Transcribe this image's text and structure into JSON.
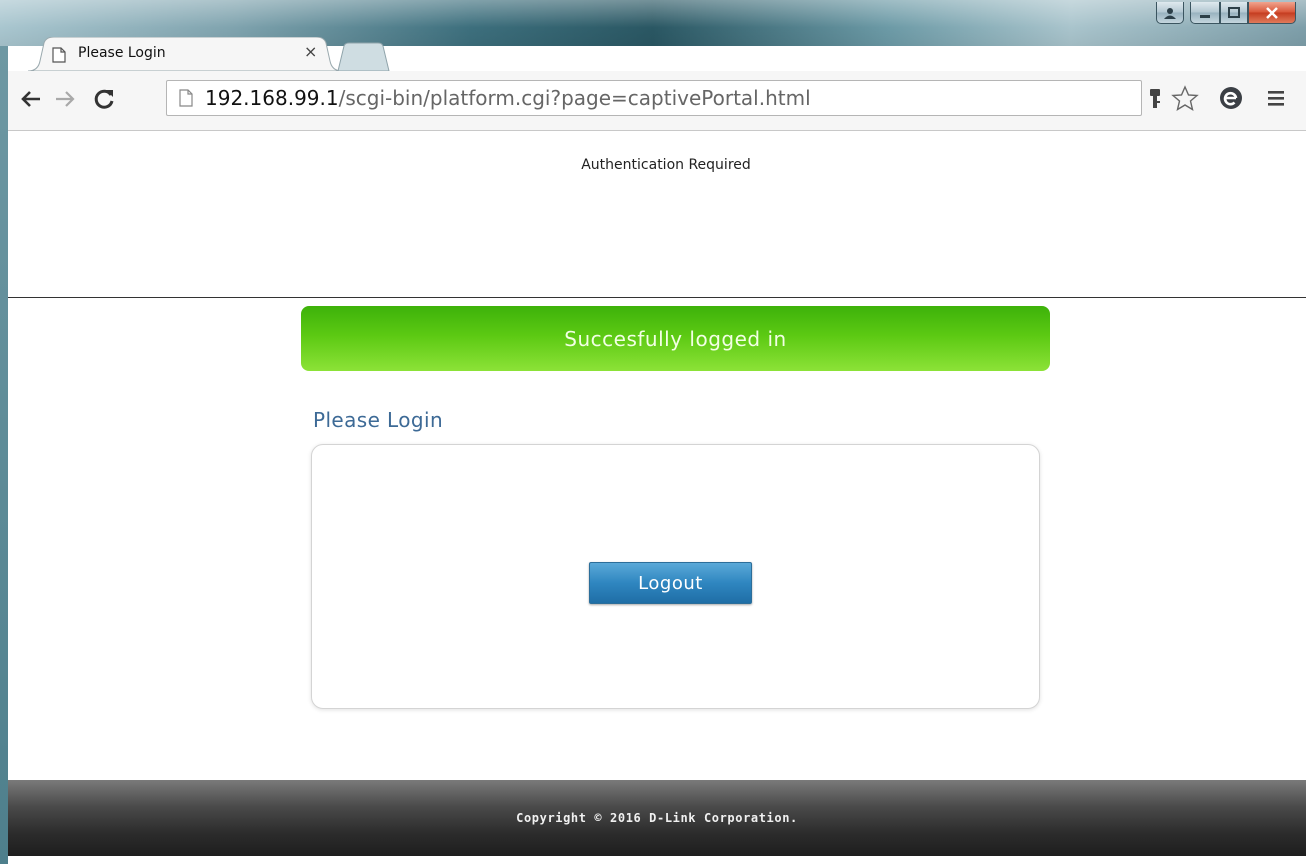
{
  "browser": {
    "tab": {
      "title": "Please Login",
      "close_glyph": "×"
    },
    "address_bar": {
      "host": "192.168.99.1",
      "path": "/scgi-bin/platform.cgi?page=captivePortal.html"
    },
    "icons": [
      "back-icon",
      "forward-icon",
      "reload-icon",
      "page-icon",
      "key-icon",
      "star-icon",
      "extension-icon",
      "menu-icon"
    ]
  },
  "page": {
    "header_text": "Authentication Required",
    "success_message": "Succesfully logged in",
    "login_heading": "Please Login",
    "logout_label": "Logout",
    "footer_text": "Copyright © 2016 D-Link Corporation."
  },
  "colors": {
    "success_green": "#5cc913",
    "heading_blue": "#3d6a96",
    "button_blue": "#2f86c0",
    "footer_dark": "#2c2c2c"
  }
}
